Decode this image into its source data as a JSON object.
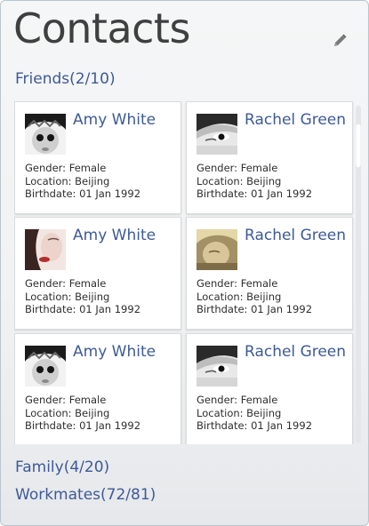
{
  "header": {
    "title": "Contacts",
    "edit_icon": "pencil-icon"
  },
  "groups": [
    {
      "label": "Friends(2/10)"
    },
    {
      "label": "Family(4/20)"
    },
    {
      "label": "Workmates(72/81)"
    }
  ],
  "contacts": [
    {
      "name": "Amy White",
      "gender": "Gender: Female",
      "location": "Location: Beijing",
      "birthdate": "Birthdate: 01 Jan 1992"
    },
    {
      "name": "Rachel Green",
      "gender": "Gender: Female",
      "location": "Location: Beijing",
      "birthdate": "Birthdate: 01 Jan 1992"
    },
    {
      "name": "Amy White",
      "gender": "Gender: Female",
      "location": "Location: Beijing",
      "birthdate": "Birthdate: 01 Jan 1992"
    },
    {
      "name": "Rachel Green",
      "gender": "Gender: Female",
      "location": "Location: Beijing",
      "birthdate": "Birthdate: 01 Jan 1992"
    },
    {
      "name": "Amy White",
      "gender": "Gender: Female",
      "location": "Location: Beijing",
      "birthdate": "Birthdate: 01 Jan 1992"
    },
    {
      "name": "Rachel Green",
      "gender": "Gender: Female",
      "location": "Location: Beijing",
      "birthdate": "Birthdate: 01 Jan 1992"
    }
  ],
  "colors": {
    "accent": "#3d5a98",
    "title": "#3f3f3f",
    "text": "#2e2e2e"
  }
}
